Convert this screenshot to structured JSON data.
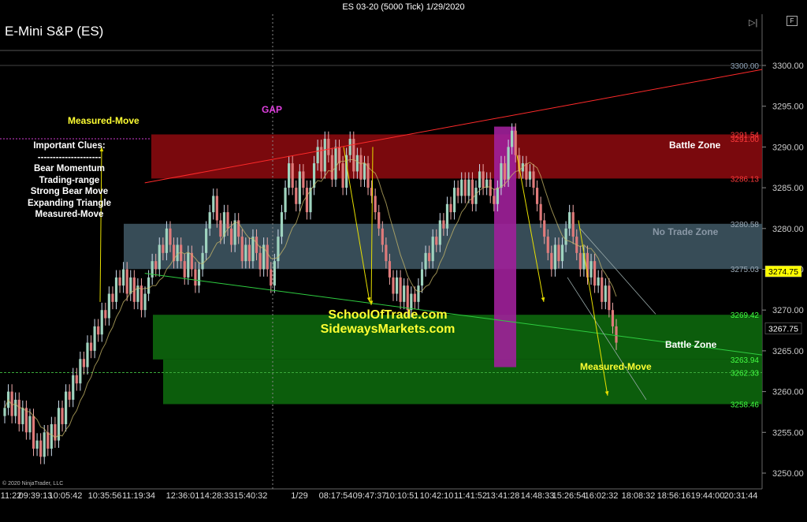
{
  "window": {
    "title": "ES 03-20 (5000 Tick)  1/29/2020",
    "instrument": "E-Mini S&P (ES)",
    "copyright": "© 2020 NinjaTrader, LLC",
    "f_button": "F"
  },
  "colors": {
    "background": "#000000",
    "red_zone": "#8b0a0f",
    "blue_zone": "#3f5663",
    "green_zone": "#0e6a0e",
    "gap_bar": "#a0209a",
    "up_candle": "#9fd4bf",
    "down_candle": "#e07a7a",
    "annotation": "#ffff33"
  },
  "clues": [
    "Important Clues:",
    "---------------------",
    "Bear Momentum",
    "Trading-range",
    "Strong Bear Move",
    "Expanding Triangle",
    "Measured-Move"
  ],
  "chart_data": {
    "type": "candlestick",
    "y_ticks": [
      3250,
      3255,
      3260,
      3265,
      3270,
      3275,
      3280,
      3285,
      3290,
      3295,
      3300
    ],
    "y_tick_labels": [
      "3250.00",
      "3255.00",
      "3260.00",
      "3265.00",
      "3270.00",
      "3275.00",
      "3280.00",
      "3285.00",
      "3290.00",
      "3295.00",
      "3300.00"
    ],
    "ylim": [
      3249,
      3301.3
    ],
    "x_tick_labels": [
      "11:22",
      "09:39:13",
      "10:05:42",
      "10:35:56",
      "11:19:34",
      "12:36:01",
      "14:28:33",
      "15:40:32",
      "1/29",
      "08:17:54",
      "09:47:37",
      "10:10:51",
      "10:42:10",
      "11:41:52",
      "13:41:28",
      "14:48:33",
      "15:26:54",
      "16:02:32",
      "18:08:32",
      "18:56:16",
      "19:44:00",
      "20:31:44"
    ],
    "zones": [
      {
        "name": "Battle Zone",
        "top": 3291.54,
        "bottom": 3286.13,
        "color": "#8b0a0f"
      },
      {
        "name": "No Trade Zone",
        "top": 3280.58,
        "bottom": 3275.03,
        "color": "#3f5663"
      },
      {
        "name": "",
        "top": 3269.42,
        "bottom": 3263.94,
        "color": "#0e6a0e"
      },
      {
        "name": "Battle Zone",
        "top": 3263.94,
        "bottom": 3258.46,
        "color": "#0e6a0e"
      }
    ],
    "price_labels": [
      {
        "text": "3300.00",
        "value": 3300.0,
        "color": "#8ea3b8"
      },
      {
        "text": "3291.54",
        "value": 3291.54,
        "color": "#ff3b3b"
      },
      {
        "text": "3291.00",
        "value": 3291.0,
        "color": "#ff3b3b"
      },
      {
        "text": "3286.13",
        "value": 3286.13,
        "color": "#ff3b3b"
      },
      {
        "text": "3280.58",
        "value": 3280.58,
        "color": "#9aa8b5"
      },
      {
        "text": "3275.03",
        "value": 3275.03,
        "color": "#9aa8b5"
      },
      {
        "text": "3269.42",
        "value": 3269.42,
        "color": "#44ff44"
      },
      {
        "text": "3263.94",
        "value": 3263.94,
        "color": "#44ff44"
      },
      {
        "text": "3262.33",
        "value": 3262.33,
        "color": "#44ff44"
      },
      {
        "text": "3258.46",
        "value": 3258.46,
        "color": "#44ff44"
      }
    ],
    "price_markers": [
      {
        "text": "3274.75",
        "value": 3274.75,
        "bg": "#ffff00",
        "fg": "#000000"
      },
      {
        "text": "3267.75",
        "value": 3267.75,
        "bg": "#000000",
        "fg": "#ffffff"
      }
    ],
    "annotations": {
      "gap": "GAP",
      "measured_move_top": "Measured-Move",
      "measured_move_bottom": "Measured-Move",
      "battle_zone_upper": "Battle Zone",
      "battle_zone_lower": "Battle Zone",
      "no_trade_zone": "No Trade Zone",
      "site1": "SchoolOfTrade.com",
      "site2": "SidewaysMarkets.com"
    },
    "closes": [
      3258,
      3260,
      3257,
      3259,
      3256,
      3258,
      3255,
      3257,
      3253,
      3254,
      3252,
      3255,
      3253,
      3256,
      3254,
      3258,
      3256,
      3260,
      3259,
      3262,
      3261,
      3264,
      3263,
      3266,
      3265,
      3268,
      3267,
      3270,
      3269,
      3272,
      3271,
      3274,
      3273,
      3275,
      3272,
      3274,
      3271,
      3273,
      3270,
      3272,
      3274,
      3276,
      3275,
      3278,
      3277,
      3280,
      3278,
      3276,
      3278,
      3276,
      3274,
      3277,
      3275,
      3273,
      3275,
      3277,
      3280,
      3282,
      3284,
      3281,
      3279,
      3282,
      3280,
      3278,
      3281,
      3279,
      3276,
      3278,
      3276,
      3279,
      3277,
      3275,
      3278,
      3275,
      3273,
      3276,
      3279,
      3282,
      3285,
      3288,
      3285,
      3283,
      3287,
      3285,
      3282,
      3285,
      3288,
      3290,
      3287,
      3291,
      3289,
      3286,
      3290,
      3288,
      3285,
      3289,
      3291,
      3287,
      3289,
      3286,
      3288,
      3285,
      3284,
      3282,
      3280,
      3278,
      3276,
      3274,
      3272,
      3274,
      3271,
      3273,
      3270,
      3272,
      3271,
      3273,
      3275,
      3277,
      3276,
      3279,
      3278,
      3281,
      3280,
      3283,
      3282,
      3285,
      3284,
      3286,
      3284,
      3286,
      3283,
      3285,
      3287,
      3285,
      3286,
      3284,
      3283,
      3285,
      3288,
      3286,
      3290,
      3292,
      3289,
      3287,
      3288,
      3286,
      3287,
      3285,
      3283,
      3281,
      3279,
      3277,
      3275,
      3278,
      3276,
      3278,
      3280,
      3282,
      3279,
      3277,
      3275,
      3277,
      3274,
      3276,
      3273,
      3274,
      3271,
      3273,
      3270,
      3268,
      3266
    ],
    "lines": [
      {
        "name": "",
        "color": "#ff2a2a",
        "points": [
          [
            0.19,
            3285.6
          ],
          [
            1.0,
            3299.5
          ]
        ]
      },
      {
        "name": "",
        "color": "#2ecc40",
        "points": [
          [
            0.19,
            3274.5
          ],
          [
            1.0,
            3264.5
          ]
        ]
      }
    ]
  }
}
